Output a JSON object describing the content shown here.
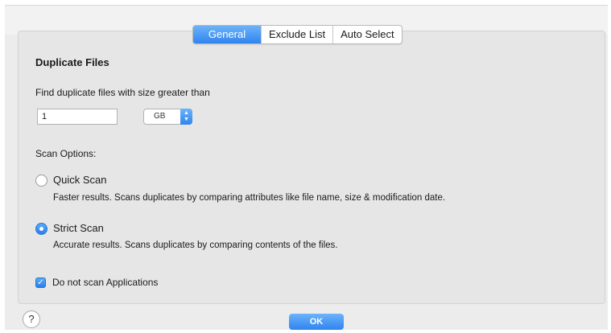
{
  "tabs": [
    {
      "label": "General",
      "active": true
    },
    {
      "label": "Exclude List",
      "active": false
    },
    {
      "label": "Auto Select",
      "active": false
    }
  ],
  "section_title": "Duplicate Files",
  "find_label": "Find duplicate files with size greater than",
  "size_value": "1",
  "size_unit": "GB",
  "scan_options_label": "Scan Options:",
  "quick_scan": {
    "label": "Quick Scan",
    "description": "Faster results. Scans duplicates by comparing attributes like file name, size & modification date.",
    "selected": false
  },
  "strict_scan": {
    "label": "Strict Scan",
    "description": "Accurate results. Scans duplicates by comparing contents of the files.",
    "selected": true
  },
  "skip_apps": {
    "label": "Do not scan Applications",
    "checked": true
  },
  "help_label": "?",
  "ok_label": "OK",
  "colors": {
    "accent": "#2f84ee",
    "panel": "#e6e6e6"
  },
  "icons": {
    "help": "question-mark-icon",
    "checkbox": "checkmark-icon",
    "select": "updown-chevron-icon"
  }
}
